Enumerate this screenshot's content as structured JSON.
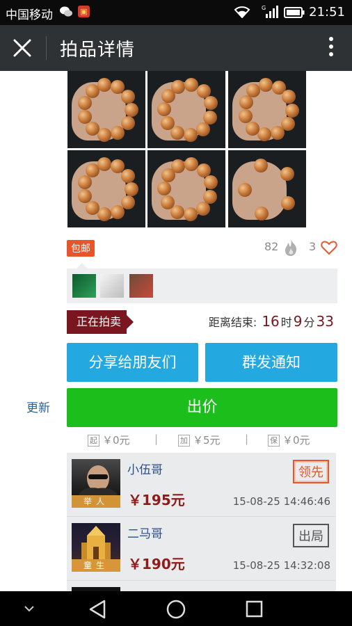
{
  "status_bar": {
    "carrier": "中国移动",
    "network": "G",
    "time": "21:51",
    "icons": [
      "wechat-icon",
      "app-notification-icon",
      "wifi-icon",
      "signal-icon",
      "battery-icon"
    ]
  },
  "title_bar": {
    "title": "拍品详情",
    "icons": [
      "close-icon",
      "more-vertical-icon"
    ]
  },
  "item": {
    "badge": "包邮",
    "views": "82",
    "likes": "3"
  },
  "auction": {
    "status": "正在拍卖",
    "countdown_label": "距离结束:",
    "hours": "16",
    "hours_unit": "时",
    "minutes": "9",
    "minutes_unit": "分",
    "seconds": "33"
  },
  "buttons": {
    "share": "分享给朋友们",
    "notify": "群发通知",
    "update": "更新",
    "bid": "出价"
  },
  "params": [
    {
      "tag": "起",
      "value": "￥0元"
    },
    {
      "tag": "加",
      "value": "￥5元"
    },
    {
      "tag": "保",
      "value": "￥0元"
    }
  ],
  "params_separator": "|",
  "bids": [
    {
      "name": "小伍哥",
      "role": "举人",
      "price": "￥195元",
      "time": "15-08-25 14:46:46",
      "status": "领先"
    },
    {
      "name": "二马哥",
      "role": "童生",
      "price": "￥190元",
      "time": "15-08-25 14:32:08",
      "status": "出局"
    }
  ],
  "colors": {
    "title_bar": "#2f3234",
    "share_button": "#24a8e0",
    "bid_button": "#1cbe1c",
    "status_tag": "#7a1620",
    "free_shipping": "#e8552a",
    "leading_stamp": "#e5582d"
  }
}
